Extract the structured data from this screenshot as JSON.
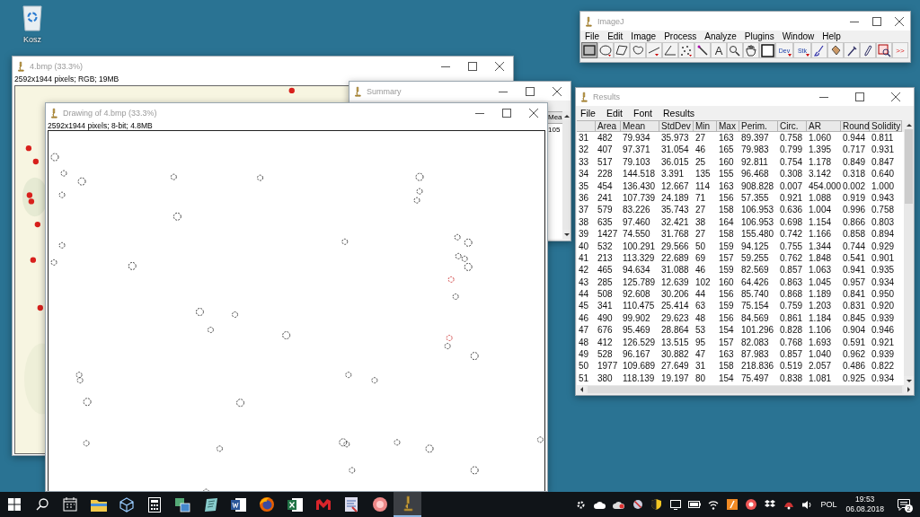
{
  "desktop": {
    "icons": [
      {
        "label": "Kosz"
      }
    ]
  },
  "image_window": {
    "title": "4.bmp (33.3%)",
    "info": "2592x1944 pixels; RGB; 19MB"
  },
  "summary_window": {
    "title": "Summary",
    "columns": [
      "Mea"
    ],
    "rows": [
      [
        "105"
      ]
    ]
  },
  "drawing_window": {
    "title": "Drawing of 4.bmp (33.3%)",
    "info": "2592x1944 pixels; 8-bit; 4.8MB"
  },
  "imagej_window": {
    "title": "ImageJ",
    "menu": [
      "File",
      "Edit",
      "Image",
      "Process",
      "Analyze",
      "Plugins",
      "Window",
      "Help"
    ],
    "tools": [
      {
        "kind": "rectangle",
        "selected": true
      },
      {
        "kind": "oval",
        "selected": false
      },
      {
        "kind": "polygon",
        "selected": false
      },
      {
        "kind": "freehand",
        "selected": false
      },
      {
        "kind": "line",
        "selected": false
      },
      {
        "kind": "angle",
        "selected": false
      },
      {
        "kind": "point",
        "selected": false
      },
      {
        "kind": "wand",
        "selected": false
      },
      {
        "kind": "text",
        "label": "A",
        "selected": false
      },
      {
        "kind": "magnifier",
        "selected": false
      },
      {
        "kind": "hand",
        "selected": false
      },
      {
        "kind": "color",
        "selected": false
      },
      {
        "kind": "menu",
        "label": "Dev",
        "selected": false
      },
      {
        "kind": "menu",
        "label": "Stk",
        "selected": false
      },
      {
        "kind": "brush",
        "selected": false
      },
      {
        "kind": "fill",
        "selected": false
      },
      {
        "kind": "pipette",
        "selected": false
      },
      {
        "kind": "pencil",
        "selected": false
      },
      {
        "kind": "lut",
        "selected": false
      },
      {
        "kind": "more",
        "label": ">>",
        "selected": false
      }
    ]
  },
  "results_window": {
    "title": "Results",
    "menu": [
      "File",
      "Edit",
      "Font",
      "Results"
    ],
    "columns": [
      "",
      "Area",
      "Mean",
      "StdDev",
      "Min",
      "Max",
      "Perim.",
      "Circ.",
      "AR",
      "Round",
      "Solidity"
    ],
    "rows": [
      [
        "31",
        "482",
        "79.934",
        "35.973",
        "27",
        "163",
        "89.397",
        "0.758",
        "1.060",
        "0.944",
        "0.811"
      ],
      [
        "32",
        "407",
        "97.371",
        "31.054",
        "46",
        "165",
        "79.983",
        "0.799",
        "1.395",
        "0.717",
        "0.931"
      ],
      [
        "33",
        "517",
        "79.103",
        "36.015",
        "25",
        "160",
        "92.811",
        "0.754",
        "1.178",
        "0.849",
        "0.847"
      ],
      [
        "34",
        "228",
        "144.518",
        "3.391",
        "135",
        "155",
        "96.468",
        "0.308",
        "3.142",
        "0.318",
        "0.640"
      ],
      [
        "35",
        "454",
        "136.430",
        "12.667",
        "114",
        "163",
        "908.828",
        "0.007",
        "454.000",
        "0.002",
        "1.000"
      ],
      [
        "36",
        "241",
        "107.739",
        "24.189",
        "71",
        "156",
        "57.355",
        "0.921",
        "1.088",
        "0.919",
        "0.943"
      ],
      [
        "37",
        "579",
        "83.226",
        "35.743",
        "27",
        "158",
        "106.953",
        "0.636",
        "1.004",
        "0.996",
        "0.758"
      ],
      [
        "38",
        "635",
        "97.460",
        "32.421",
        "38",
        "164",
        "106.953",
        "0.698",
        "1.154",
        "0.866",
        "0.803"
      ],
      [
        "39",
        "1427",
        "74.550",
        "31.768",
        "27",
        "158",
        "155.480",
        "0.742",
        "1.166",
        "0.858",
        "0.894"
      ],
      [
        "40",
        "532",
        "100.291",
        "29.566",
        "50",
        "159",
        "94.125",
        "0.755",
        "1.344",
        "0.744",
        "0.929"
      ],
      [
        "41",
        "213",
        "113.329",
        "22.689",
        "69",
        "157",
        "59.255",
        "0.762",
        "1.848",
        "0.541",
        "0.901"
      ],
      [
        "42",
        "465",
        "94.634",
        "31.088",
        "46",
        "159",
        "82.569",
        "0.857",
        "1.063",
        "0.941",
        "0.935"
      ],
      [
        "43",
        "285",
        "125.789",
        "12.639",
        "102",
        "160",
        "64.426",
        "0.863",
        "1.045",
        "0.957",
        "0.934"
      ],
      [
        "44",
        "508",
        "92.608",
        "30.206",
        "44",
        "156",
        "85.740",
        "0.868",
        "1.189",
        "0.841",
        "0.950"
      ],
      [
        "45",
        "341",
        "110.475",
        "25.414",
        "63",
        "159",
        "75.154",
        "0.759",
        "1.203",
        "0.831",
        "0.920"
      ],
      [
        "46",
        "490",
        "99.902",
        "29.623",
        "48",
        "156",
        "84.569",
        "0.861",
        "1.184",
        "0.845",
        "0.939"
      ],
      [
        "47",
        "676",
        "95.469",
        "28.864",
        "53",
        "154",
        "101.296",
        "0.828",
        "1.106",
        "0.904",
        "0.946"
      ],
      [
        "48",
        "412",
        "126.529",
        "13.515",
        "95",
        "157",
        "82.083",
        "0.768",
        "1.693",
        "0.591",
        "0.921"
      ],
      [
        "49",
        "528",
        "96.167",
        "30.882",
        "47",
        "163",
        "87.983",
        "0.857",
        "1.040",
        "0.962",
        "0.939"
      ],
      [
        "50",
        "1977",
        "109.689",
        "27.649",
        "31",
        "158",
        "218.836",
        "0.519",
        "2.057",
        "0.486",
        "0.822"
      ],
      [
        "51",
        "380",
        "118.139",
        "19.197",
        "80",
        "154",
        "75.497",
        "0.838",
        "1.081",
        "0.925",
        "0.934"
      ]
    ]
  },
  "taskbar": {
    "apps": [
      {
        "kind": "start",
        "active": false
      },
      {
        "kind": "search",
        "active": false
      },
      {
        "kind": "calendar",
        "active": false
      },
      {
        "kind": "folder",
        "active": false
      },
      {
        "kind": "cube",
        "active": false
      },
      {
        "kind": "calculator",
        "active": false
      },
      {
        "kind": "windows",
        "active": false
      },
      {
        "kind": "notebook",
        "active": false
      },
      {
        "kind": "word",
        "active": false
      },
      {
        "kind": "firefox",
        "active": false
      },
      {
        "kind": "excel",
        "active": false
      },
      {
        "kind": "mendeley",
        "active": false
      },
      {
        "kind": "document",
        "active": false
      },
      {
        "kind": "redcircle",
        "active": false
      },
      {
        "kind": "microscope",
        "active": true
      }
    ],
    "tray": [
      {
        "kind": "gear"
      },
      {
        "kind": "cloud"
      },
      {
        "kind": "redcloud"
      },
      {
        "kind": "blocked"
      },
      {
        "kind": "shield"
      },
      {
        "kind": "monitor"
      },
      {
        "kind": "battery"
      },
      {
        "kind": "wifi"
      },
      {
        "kind": "orange"
      },
      {
        "kind": "redcircle"
      },
      {
        "kind": "dropbox"
      },
      {
        "kind": "redmouse"
      },
      {
        "kind": "speaker"
      }
    ],
    "language": "POL",
    "time": "19:53",
    "date": "06.08.2018",
    "notifications": "2"
  }
}
